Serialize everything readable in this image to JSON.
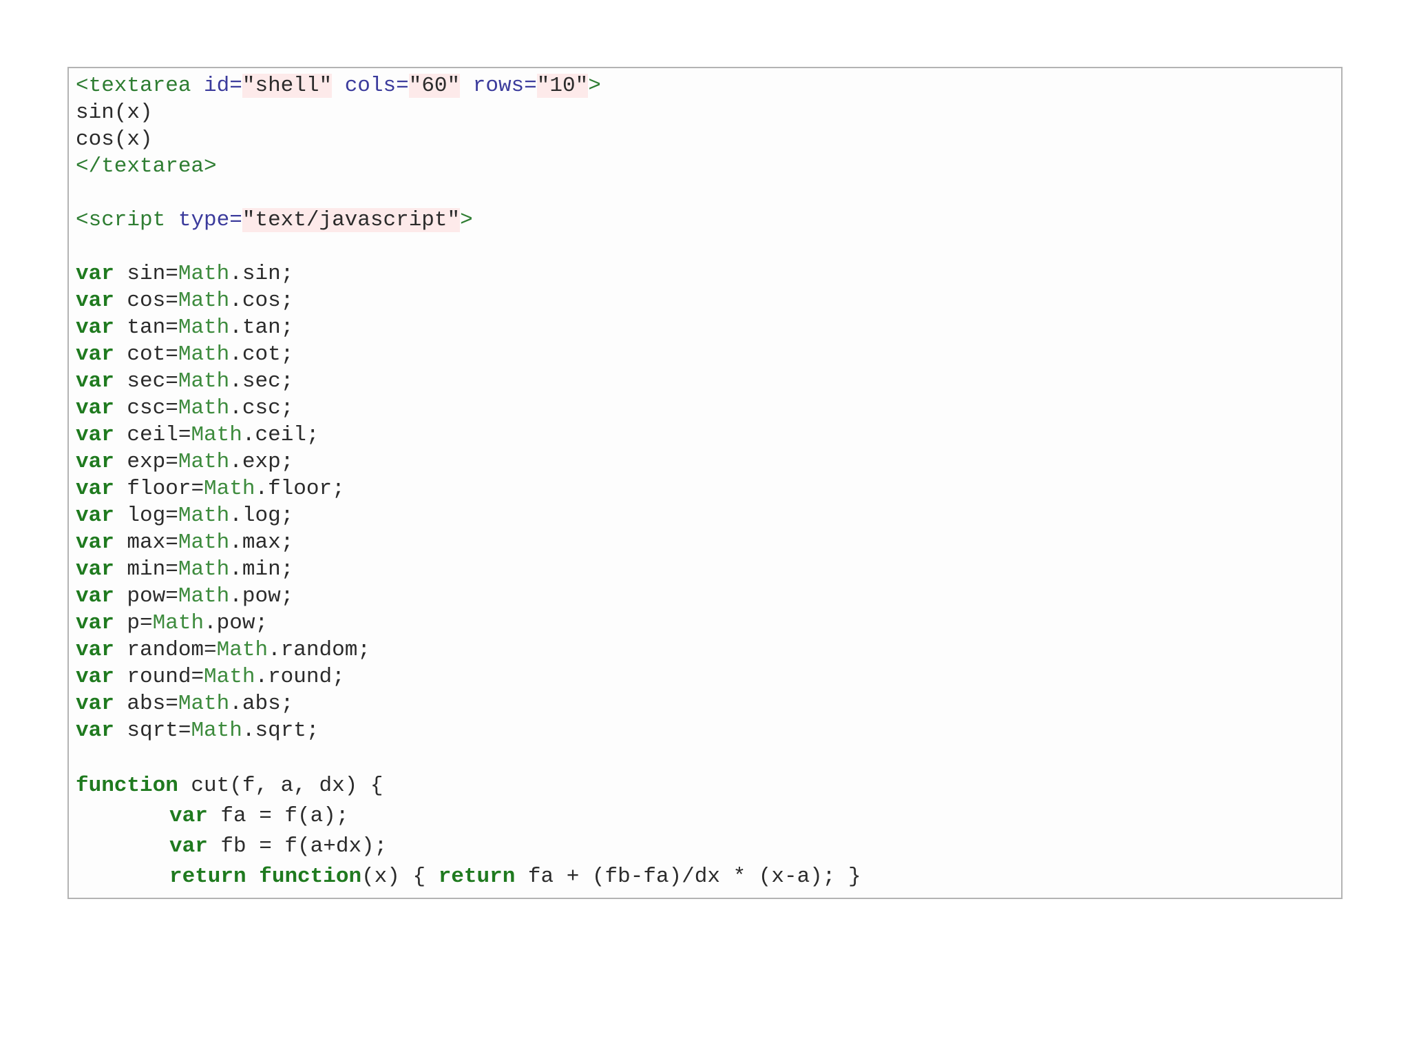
{
  "textarea_open": {
    "tag": "<textarea",
    "id_attr": "id=",
    "id_val": "\"shell\"",
    "cols_attr": "cols=",
    "cols_val": "\"60\"",
    "rows_attr": "rows=",
    "rows_val": "\"10\"",
    "close": ">"
  },
  "textarea_body": [
    "sin(x)",
    "cos(x)"
  ],
  "textarea_close": "</textarea>",
  "script_open": {
    "tag": "<script",
    "type_attr": "type=",
    "type_val": "\"text/javascript\"",
    "close": ">"
  },
  "keyword_var": "var",
  "math_name": "Math",
  "var_lines": [
    {
      "name": "sin",
      "prop": "sin"
    },
    {
      "name": "cos",
      "prop": "cos"
    },
    {
      "name": "tan",
      "prop": "tan"
    },
    {
      "name": "cot",
      "prop": "cot"
    },
    {
      "name": "sec",
      "prop": "sec"
    },
    {
      "name": "csc",
      "prop": "csc"
    },
    {
      "name": "ceil",
      "prop": "ceil"
    },
    {
      "name": "exp",
      "prop": "exp"
    },
    {
      "name": "floor",
      "prop": "floor"
    },
    {
      "name": "log",
      "prop": "log"
    },
    {
      "name": "max",
      "prop": "max"
    },
    {
      "name": "min",
      "prop": "min"
    },
    {
      "name": "pow",
      "prop": "pow"
    },
    {
      "name": "p",
      "prop": "pow"
    },
    {
      "name": "random",
      "prop": "random"
    },
    {
      "name": "round",
      "prop": "round"
    },
    {
      "name": "abs",
      "prop": "abs"
    },
    {
      "name": "sqrt",
      "prop": "sqrt"
    }
  ],
  "function_def": {
    "keyword": "function",
    "signature": " cut(f, a, dx) {"
  },
  "body_lines": [
    {
      "kw": "var",
      "rest": " fa = f(a);"
    },
    {
      "kw": "var",
      "rest": " fb = f(a+dx);"
    }
  ],
  "return_line": {
    "kw_return": "return",
    "kw_function": "function",
    "mid": "(x) { ",
    "kw_return2": "return",
    "tail": " fa + (fb-fa)/dx * (x-a); }"
  },
  "colors": {
    "tag": "#2e7d32",
    "attribute": "#3b3b9c",
    "string_bg": "#fdeaea",
    "keyword": "#1f7a1f",
    "builtin": "#3d8b3d",
    "border": "#b3b3b3"
  }
}
